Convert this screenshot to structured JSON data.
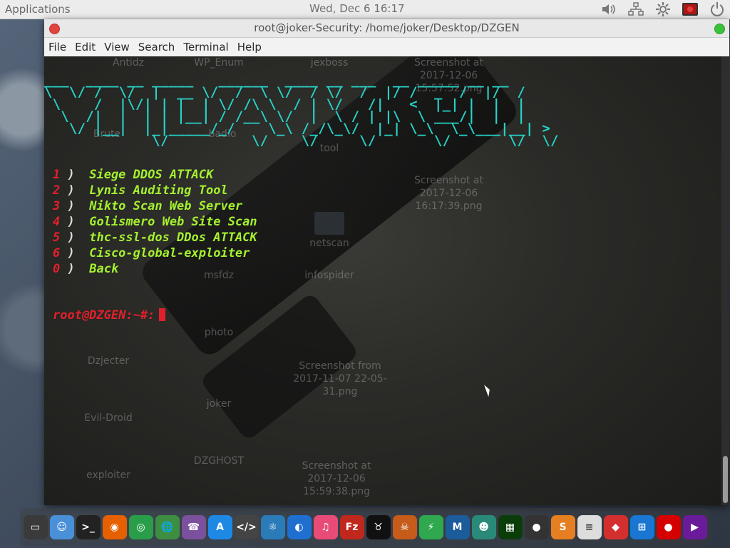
{
  "top_panel": {
    "applications": "Applications",
    "clock": "Wed, Dec  6  16:17",
    "icons": [
      "volume-icon",
      "network-icon",
      "settings-icon",
      "screen-recorder-icon",
      "power-icon"
    ]
  },
  "window": {
    "title": "root@joker-Security: /home/joker/Desktop/DZGEN"
  },
  "menubar": [
    "File",
    "Edit",
    "View",
    "Search",
    "Terminal",
    "Help"
  ],
  "terminal": {
    "banner_color": "#27d3c8",
    "menu": [
      {
        "num": "1",
        "label": "Siege DDOS ATTACK"
      },
      {
        "num": "2",
        "label": "Lynis Auditing Tool"
      },
      {
        "num": "3",
        "label": "Nikto Scan Web Server"
      },
      {
        "num": "4",
        "label": "Golismero Web Site Scan"
      },
      {
        "num": "5",
        "label": "thc-ssl-dos DDos ATTACK"
      },
      {
        "num": "6",
        "label": "Cisco-global-exploiter"
      },
      {
        "num": "0",
        "label": "Back"
      }
    ],
    "prompt": "root@DZGEN:~#:",
    "colors": {
      "number": "#e3202a",
      "option": "#a5f12f",
      "prompt": "#e3202a"
    }
  },
  "desktop_icons": [
    "Antidz",
    "WP_Enum",
    "jexboss",
    "Screenshot at 2017-12-06 15:57:52.png",
    "Brute",
    "badio",
    "tool",
    "netscan",
    "Screenshot at 2017-12-06 16:17:39.png",
    "msfdz",
    "infospider",
    "photo",
    "Dzjecter",
    "Screenshot from 2017-11-07 22-05-31.png",
    "joker",
    "Evil-Droid",
    "DZGHOST",
    "exploiter",
    "Screenshot at 2017-12-06 15:59:38.png"
  ],
  "dock": [
    {
      "name": "display-settings-icon",
      "color": "#3a3a3a",
      "glyph": "▭"
    },
    {
      "name": "finder-icon",
      "color": "#4a90d9",
      "glyph": "☺"
    },
    {
      "name": "terminal-icon",
      "color": "#222222",
      "glyph": ">_"
    },
    {
      "name": "firefox-icon",
      "color": "#e66000",
      "glyph": "◉"
    },
    {
      "name": "chrome-icon",
      "color": "#2a9d4a",
      "glyph": "◎"
    },
    {
      "name": "globe-icon",
      "color": "#3e8e41",
      "glyph": "🌐"
    },
    {
      "name": "viber-icon",
      "color": "#7b519d",
      "glyph": "☎"
    },
    {
      "name": "app-store-icon",
      "color": "#1e88e5",
      "glyph": "A"
    },
    {
      "name": "code-editor-icon",
      "color": "#444444",
      "glyph": "</>"
    },
    {
      "name": "atom-icon",
      "color": "#2b7bb9",
      "glyph": "⚛"
    },
    {
      "name": "safari-icon",
      "color": "#1f6fd1",
      "glyph": "◐"
    },
    {
      "name": "music-icon",
      "color": "#e94b77",
      "glyph": "♫"
    },
    {
      "name": "filezilla-icon",
      "color": "#c0271d",
      "glyph": "Fz"
    },
    {
      "name": "bull-icon",
      "color": "#111111",
      "glyph": "♉"
    },
    {
      "name": "skull-icon",
      "color": "#c65b1a",
      "glyph": "☠"
    },
    {
      "name": "lightning-icon",
      "color": "#2fa84f",
      "glyph": "⚡"
    },
    {
      "name": "metasploit-icon",
      "color": "#1c5c9a",
      "glyph": "M"
    },
    {
      "name": "anime-icon",
      "color": "#2a8a7a",
      "glyph": "☻"
    },
    {
      "name": "matrix-icon",
      "color": "#0b3d0b",
      "glyph": "▦"
    },
    {
      "name": "palette-icon",
      "color": "#333333",
      "glyph": "●"
    },
    {
      "name": "sublime-icon",
      "color": "#e67e22",
      "glyph": "S"
    },
    {
      "name": "notes-icon",
      "color": "#dddddd",
      "glyph": "≡"
    },
    {
      "name": "diamond-icon",
      "color": "#d32f2f",
      "glyph": "◆"
    },
    {
      "name": "windows-icon",
      "color": "#1976d2",
      "glyph": "⊞"
    },
    {
      "name": "record-icon",
      "color": "#d50000",
      "glyph": "●"
    },
    {
      "name": "video-editor-icon",
      "color": "#6a1b9a",
      "glyph": "▶"
    }
  ]
}
